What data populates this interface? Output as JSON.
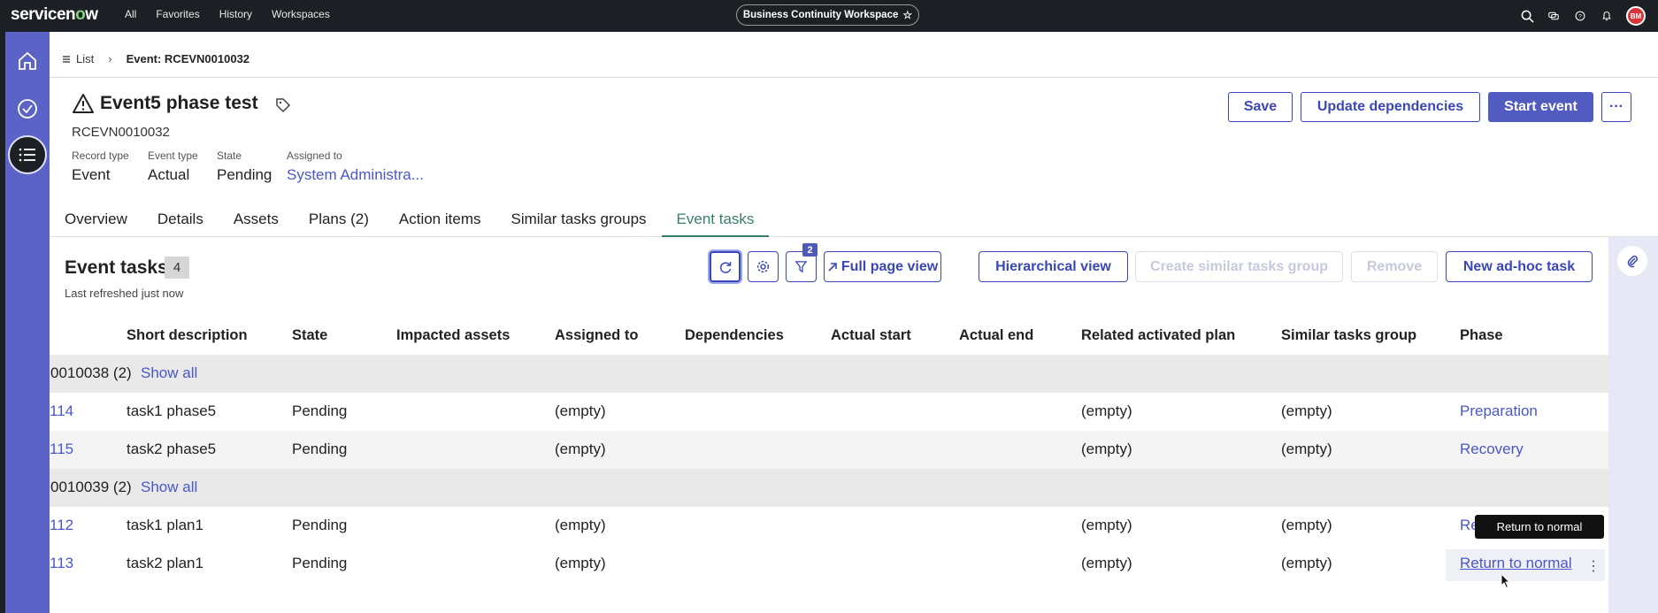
{
  "topnav": {
    "logo": "servicenow",
    "menu": [
      "All",
      "Favorites",
      "History",
      "Workspaces"
    ],
    "workspace": "Business Continuity Workspace",
    "avatar": "BM"
  },
  "breadcrumb": {
    "list_label": "List",
    "current": "Event: RCEVN0010032"
  },
  "header": {
    "title": "Event5 phase test",
    "number": "RCEVN0010032",
    "fields": [
      {
        "label": "Record type",
        "value": "Event"
      },
      {
        "label": "Event type",
        "value": "Actual"
      },
      {
        "label": "State",
        "value": "Pending"
      },
      {
        "label": "Assigned to",
        "value": "System Administra..."
      }
    ],
    "buttons": {
      "save": "Save",
      "update": "Update dependencies",
      "start": "Start event",
      "more": "···"
    }
  },
  "tabs": [
    "Overview",
    "Details",
    "Assets",
    "Plans (2)",
    "Action items",
    "Similar tasks groups",
    "Event tasks"
  ],
  "event_tasks": {
    "title": "Event tasks",
    "count": "4",
    "refreshed": "Last refreshed just now",
    "filter_badge": "2",
    "buttons": {
      "full_page": "Full page view",
      "hierarchical": "Hierarchical view",
      "create_group": "Create similar tasks group",
      "remove": "Remove",
      "new_task": "New ad-hoc task"
    },
    "columns": [
      "Short description",
      "State",
      "Impacted assets",
      "Assigned to",
      "Dependencies",
      "Actual start",
      "Actual end",
      "Related activated plan",
      "Similar tasks group",
      "Phase"
    ],
    "groups": [
      {
        "id": "0010038 (2)",
        "show_all": "Show all",
        "rows": [
          {
            "num": "114",
            "desc": "task1 phase5",
            "state": "Pending",
            "assigned": "(empty)",
            "plan": "(empty)",
            "group": "(empty)",
            "phase": "Preparation"
          },
          {
            "num": "115",
            "desc": "task2 phase5",
            "state": "Pending",
            "assigned": "(empty)",
            "plan": "(empty)",
            "group": "(empty)",
            "phase": "Recovery"
          }
        ]
      },
      {
        "id": "0010039 (2)",
        "show_all": "Show all",
        "rows": [
          {
            "num": "112",
            "desc": "task1 plan1",
            "state": "Pending",
            "assigned": "(empty)",
            "plan": "(empty)",
            "group": "(empty)",
            "phase": "Re"
          },
          {
            "num": "113",
            "desc": "task2 plan1",
            "state": "Pending",
            "assigned": "(empty)",
            "plan": "(empty)",
            "group": "(empty)",
            "phase": "Return to normal"
          }
        ]
      }
    ],
    "tooltip": "Return to normal"
  },
  "colors": {
    "topnav": "#1c1f24",
    "rail": "#5b63c7",
    "primary": "#525cc0",
    "link": "#4957c9",
    "active_tab": "#3a7d6e"
  }
}
